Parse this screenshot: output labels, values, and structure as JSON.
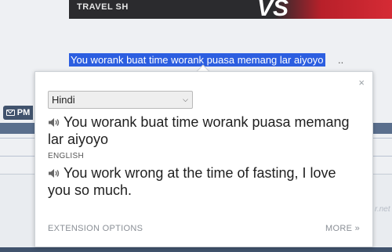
{
  "background": {
    "banner_text": "TRAVEL SH",
    "banner_vs": "VS",
    "selected_text": "You worank buat time worank puasa memang lar aiyoyo",
    "ellipsis": "..",
    "pm_label": "PM",
    "watermark": "r.net"
  },
  "popup": {
    "close_label": "×",
    "language_select": {
      "selected": "Hindi"
    },
    "source_text": "You worank buat time worank puasa memang lar aiyoyo",
    "target_language_label": "ENGLISH",
    "translated_text": "You work wrong at the time of fasting, I love you so much.",
    "footer": {
      "options_label": "EXTENSION OPTIONS",
      "more_label": "MORE »"
    }
  }
}
